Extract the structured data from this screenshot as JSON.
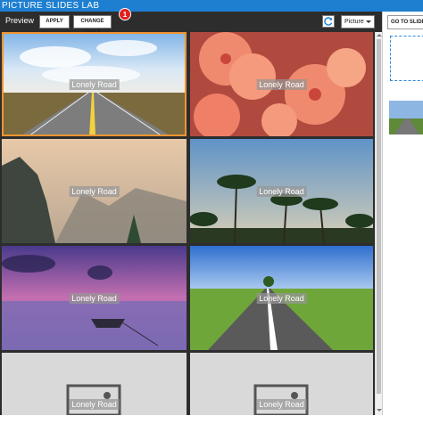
{
  "window": {
    "title": "PICTURE SLIDES LAB"
  },
  "toolbar": {
    "preview_label": "Preview",
    "apply_label": "APPLY",
    "change_style_label": "CHANGE STYLE",
    "badge_number": "1",
    "refresh_icon": "refresh-icon",
    "picture_select_value": "Picture"
  },
  "gallery": {
    "caption": "Lonely Road",
    "tiles": [
      {
        "caption": "Lonely Road",
        "scene": "road-sky",
        "selected": true
      },
      {
        "caption": "Lonely Road",
        "scene": "pink-flowers",
        "selected": false
      },
      {
        "caption": "Lonely Road",
        "scene": "misty-cliffs",
        "selected": false
      },
      {
        "caption": "Lonely Road",
        "scene": "palm-trees",
        "selected": false
      },
      {
        "caption": "Lonely Road",
        "scene": "purple-lake-boat",
        "selected": false
      },
      {
        "caption": "Lonely Road",
        "scene": "road-green-fields",
        "selected": false
      },
      {
        "caption": "Lonely Road",
        "scene": "image-placeholder",
        "selected": false
      },
      {
        "caption": "Lonely Road",
        "scene": "image-placeholder",
        "selected": false
      }
    ]
  },
  "rightpane": {
    "goto_label": "GO TO SLIDE"
  },
  "colors": {
    "accent": "#1e7fd0",
    "selection": "#f29530",
    "badge": "#e02020",
    "toolbar": "#2d2d2d"
  }
}
